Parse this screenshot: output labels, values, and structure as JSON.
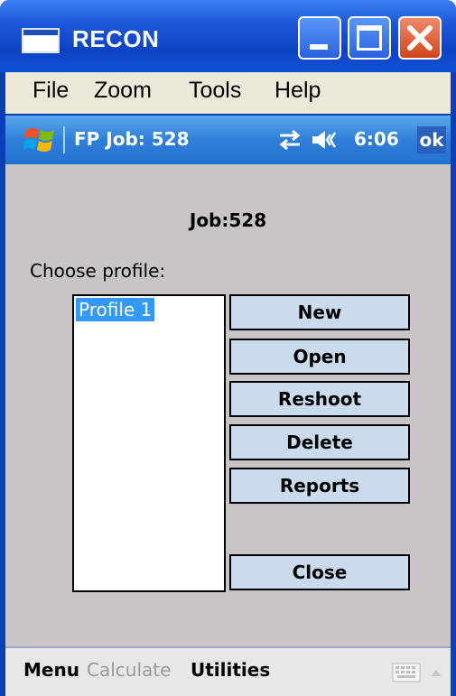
{
  "window": {
    "title": "RECON"
  },
  "menu": {
    "items": [
      "File",
      "Zoom",
      "Tools",
      "Help"
    ]
  },
  "taskbar": {
    "title": "FP Job: 528",
    "time": "6:06",
    "ok_label": "ok"
  },
  "main": {
    "job_label": "Job:528",
    "choose_label": "Choose profile:",
    "profiles": [
      "Profile 1"
    ],
    "selected_profile": "Profile 1",
    "buttons": {
      "new": "New",
      "open": "Open",
      "reshoot": "Reshoot",
      "delete": "Delete",
      "reports": "Reports",
      "close": "Close"
    }
  },
  "softkeys": {
    "menu": "Menu",
    "calculate": "Calculate",
    "utilities": "Utilities"
  },
  "colors": {
    "titlebar": "#0c43c3",
    "selection": "#3399ff",
    "button_bg": "#c9dbec",
    "content_bg": "#c8c4c8"
  },
  "icons": [
    "app-window-icon",
    "minimize-icon",
    "maximize-icon",
    "close-icon",
    "windows-logo-icon",
    "sync-icon",
    "speaker-icon",
    "keyboard-icon",
    "chevron-up-icon"
  ]
}
